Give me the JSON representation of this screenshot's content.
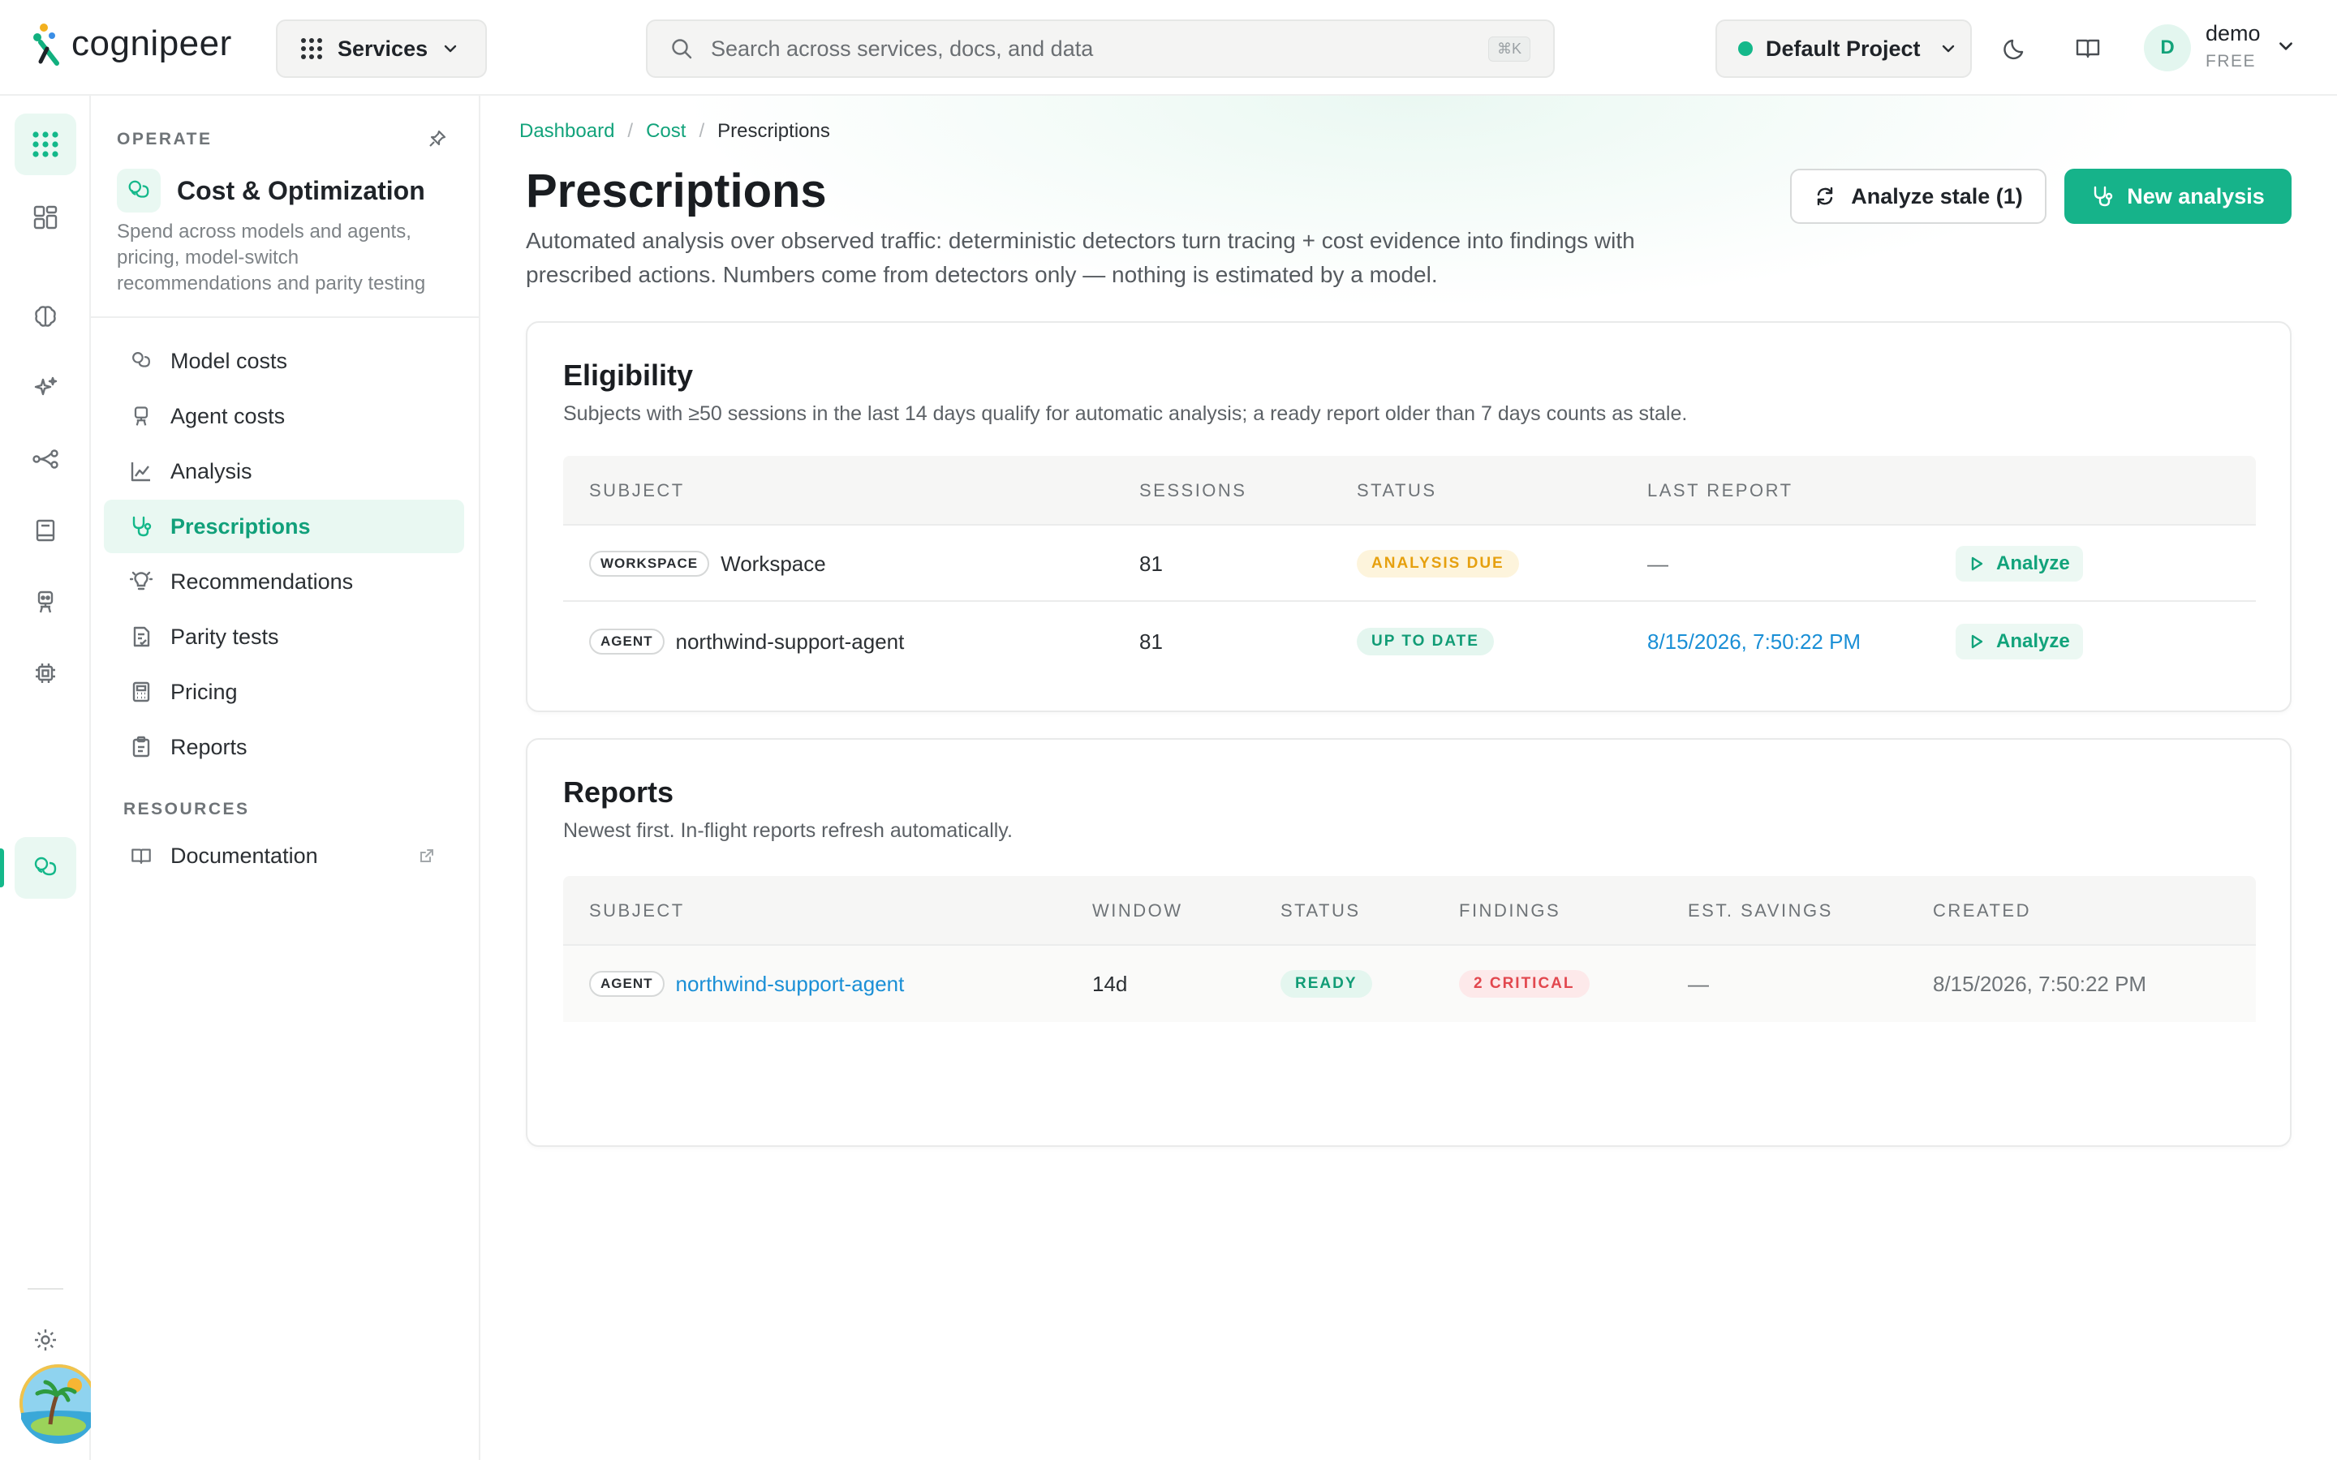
{
  "brand": {
    "name": "cognipeer"
  },
  "topbar": {
    "services_label": "Services",
    "search_placeholder": "Search across services, docs, and data",
    "search_shortcut": "⌘K",
    "project_label": "Default Project",
    "user": {
      "initial": "D",
      "name": "demo",
      "plan": "FREE"
    }
  },
  "rail": {
    "items": [
      "apps-grid-icon",
      "dashboard-icon",
      "brain-icon",
      "sparkles-icon",
      "workflow-icon",
      "book-icon",
      "agent-icon",
      "chip-icon",
      "coins-icon"
    ],
    "active": "coins-icon"
  },
  "sidebar": {
    "group_label": "OPERATE",
    "section_title": "Cost & Optimization",
    "section_desc": "Spend across models and agents, pricing, model-switch recommendations and parity testing",
    "items": [
      {
        "label": "Model costs",
        "icon": "coins-icon"
      },
      {
        "label": "Agent costs",
        "icon": "robot-icon"
      },
      {
        "label": "Analysis",
        "icon": "chart-icon"
      },
      {
        "label": "Prescriptions",
        "icon": "stethoscope-icon",
        "active": true
      },
      {
        "label": "Recommendations",
        "icon": "lightbulb-icon"
      },
      {
        "label": "Parity tests",
        "icon": "file-check-icon"
      },
      {
        "label": "Pricing",
        "icon": "calculator-icon"
      },
      {
        "label": "Reports",
        "icon": "clipboard-icon"
      }
    ],
    "resources_label": "RESOURCES",
    "resources": [
      {
        "label": "Documentation",
        "icon": "book-open-icon"
      }
    ]
  },
  "breadcrumb": {
    "items": [
      "Dashboard",
      "Cost",
      "Prescriptions"
    ],
    "separator": "/"
  },
  "page": {
    "title": "Prescriptions",
    "description": "Automated analysis over observed traffic: deterministic detectors turn tracing + cost evidence into findings with prescribed actions. Numbers come from detectors only — nothing is estimated by a model.",
    "analyze_stale_label": "Analyze stale (1)",
    "new_analysis_label": "New analysis"
  },
  "eligibility": {
    "title": "Eligibility",
    "description": "Subjects with ≥50 sessions in the last 14 days qualify for automatic analysis; a ready report older than 7 days counts as stale.",
    "columns": [
      "SUBJECT",
      "SESSIONS",
      "STATUS",
      "LAST REPORT"
    ],
    "rows": [
      {
        "tag": "WORKSPACE",
        "subject": "Workspace",
        "sessions": "81",
        "status": "ANALYSIS DUE",
        "last_report": "—",
        "action": "Analyze"
      },
      {
        "tag": "AGENT",
        "subject": "northwind-support-agent",
        "sessions": "81",
        "status": "UP TO DATE",
        "last_report": "8/15/2026, 7:50:22 PM",
        "action": "Analyze"
      }
    ]
  },
  "reports": {
    "title": "Reports",
    "description": "Newest first. In-flight reports refresh automatically.",
    "columns": [
      "SUBJECT",
      "WINDOW",
      "STATUS",
      "FINDINGS",
      "EST. SAVINGS",
      "CREATED"
    ],
    "rows": [
      {
        "tag": "AGENT",
        "subject": "northwind-support-agent",
        "window": "14d",
        "status": "READY",
        "findings": "2 CRITICAL",
        "savings": "—",
        "created": "8/15/2026, 7:50:22 PM"
      }
    ]
  },
  "colors": {
    "accent": "#16b38a",
    "link": "#1a8fd6",
    "warning": "#e6a00f",
    "danger": "#e2474e"
  }
}
